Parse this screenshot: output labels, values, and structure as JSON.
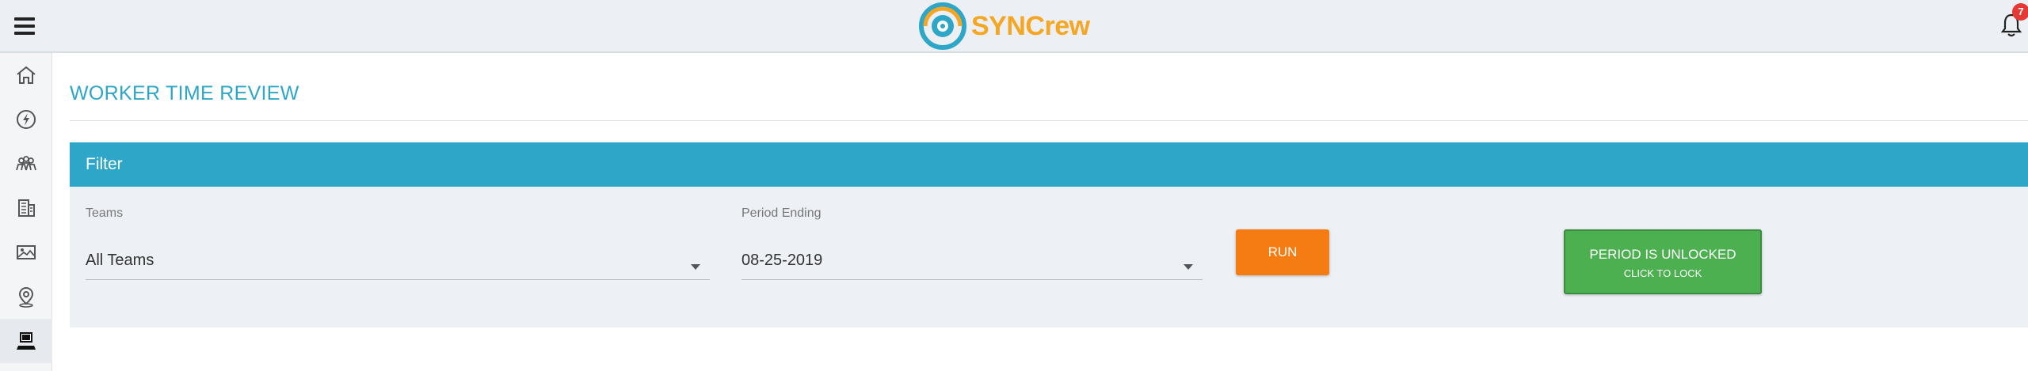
{
  "app": {
    "brand_name": "SYNCrew",
    "notification_count": "7",
    "colors": {
      "accent": "#2ea6c8",
      "brand_orange": "#f5a623",
      "run": "#f57c12",
      "unlocked": "#4caf50"
    }
  },
  "sidebar": {
    "items": [
      {
        "icon": "home-icon"
      },
      {
        "icon": "bolt-circle-icon"
      },
      {
        "icon": "team-icon"
      },
      {
        "icon": "building-icon"
      },
      {
        "icon": "image-icon"
      },
      {
        "icon": "map-pin-icon"
      },
      {
        "icon": "worker-computer-icon",
        "active": true
      }
    ]
  },
  "page": {
    "title": "WORKER TIME REVIEW"
  },
  "filter": {
    "header": "Filter",
    "teams_label": "Teams",
    "teams_value": "All Teams",
    "period_label": "Period Ending",
    "period_value": "08-25-2019",
    "run_label": "RUN",
    "lock_line1": "PERIOD IS UNLOCKED",
    "lock_line2": "CLICK TO LOCK"
  }
}
